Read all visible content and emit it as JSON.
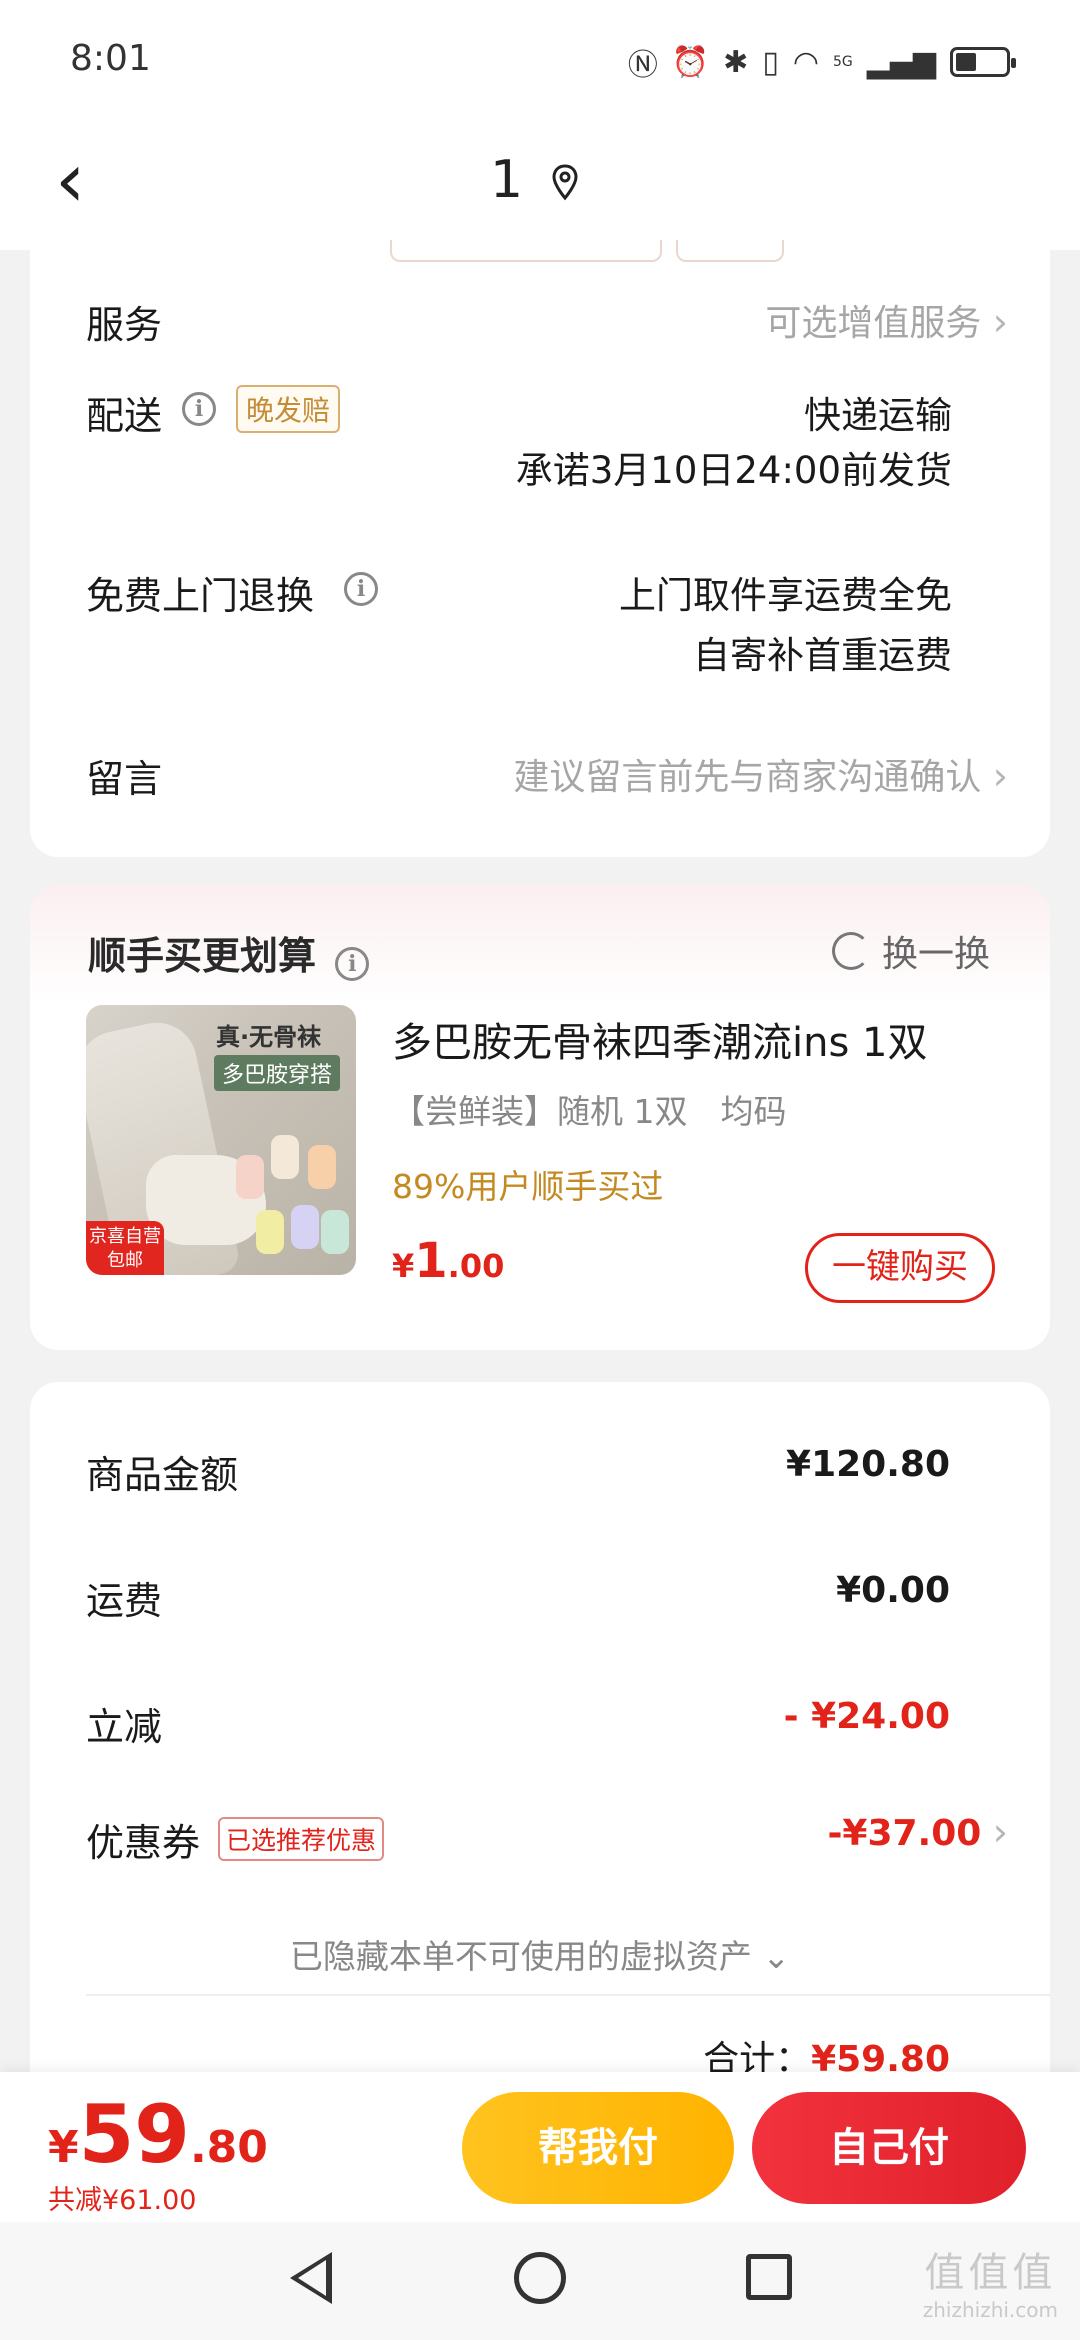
{
  "status_bar": {
    "time": "8:01",
    "network": "5G"
  },
  "header": {
    "title": "1"
  },
  "order_info": {
    "service": {
      "label": "服务",
      "value": "可选增值服务"
    },
    "delivery": {
      "label": "配送",
      "tag": "晚发赔",
      "line1": "快递运输",
      "line2": "承诺3月10日24:00前发货"
    },
    "free_return": {
      "label": "免费上门退换",
      "line1": "上门取件享运费全免",
      "line2": "自寄补首重运费"
    },
    "message": {
      "label": "留言",
      "placeholder": "建议留言前先与商家沟通确认"
    }
  },
  "recommend": {
    "title": "顺手买更划算",
    "swap_label": "换一换",
    "product": {
      "image_text1": "真·无骨袜",
      "image_text2": "多巴胺穿搭",
      "image_badge": "京喜自营 包邮",
      "title": "多巴胺无骨袜四季潮流ins 1双",
      "spec": "【尝鲜装】随机 1双　均码",
      "rate": "89%用户顺手买过",
      "price_currency": "¥",
      "price_int": "1",
      "price_dec": ".00",
      "buy_label": "一键购买"
    }
  },
  "summary": {
    "goods_label": "商品金额",
    "goods_value": "¥120.80",
    "shipping_label": "运费",
    "shipping_value": "¥0.00",
    "discount_label": "立减",
    "discount_value": "- ¥24.00",
    "coupon_label": "优惠券",
    "coupon_tag": "已选推荐优惠",
    "coupon_value": "-¥37.00",
    "hidden_assets": "已隐藏本单不可使用的虚拟资产",
    "total_label": "合计：",
    "total_value": "¥59.80"
  },
  "bottom_bar": {
    "price_currency": "¥",
    "price_int": "59",
    "price_dec": ".80",
    "saved": "共减¥61.00",
    "help_pay": "帮我付",
    "self_pay": "自己付"
  },
  "watermark": {
    "line1": "值值值",
    "line2": "zhizhizhi.com"
  },
  "colors": {
    "accent_red": "#e2231a",
    "help_yellow": "#ffb300",
    "rate_gold": "#c48a22"
  }
}
